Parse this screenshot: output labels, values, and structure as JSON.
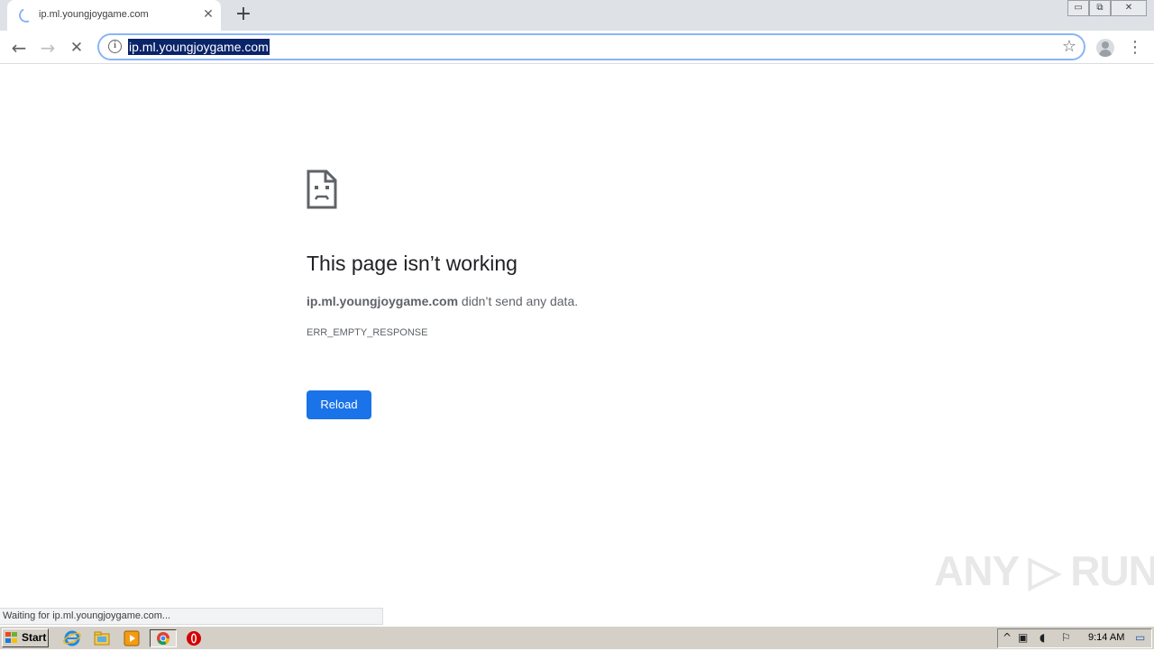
{
  "browser": {
    "tab": {
      "title": "ip.ml.youngjoygame.com",
      "close_glyph": "✕"
    },
    "new_tab_glyph": "+",
    "window_controls": {
      "minimize": "▭",
      "restore": "⧉",
      "close": "✕"
    },
    "toolbar": {
      "back_glyph": "←",
      "forward_glyph": "→",
      "stop_glyph": "✕",
      "info_glyph": "i",
      "url": "ip.ml.youngjoygame.com",
      "star_glyph": "☆",
      "menu_glyph": "⋮"
    },
    "accent_color": "#1a73e8",
    "selection_color": "#0a246a"
  },
  "error_page": {
    "icon": "sad-document-icon",
    "title": "This page isn’t working",
    "host": "ip.ml.youngjoygame.com",
    "message": " didn’t send any data.",
    "code": "ERR_EMPTY_RESPONSE",
    "reload_label": "Reload"
  },
  "status_bar": {
    "text": "Waiting for ip.ml.youngjoygame.com..."
  },
  "watermark": {
    "text": "ANY ▷ RUN"
  },
  "taskbar": {
    "start_label": "Start",
    "pinned": [
      {
        "name": "internet-explorer-icon",
        "glyph": "e"
      },
      {
        "name": "file-explorer-icon",
        "glyph": "▤"
      },
      {
        "name": "media-player-icon",
        "glyph": "▶"
      },
      {
        "name": "chrome-icon",
        "glyph": "◉"
      },
      {
        "name": "opera-icon",
        "glyph": "O"
      }
    ],
    "tray": {
      "show_hidden_glyph": "^",
      "network_glyph": "▣",
      "volume_glyph": "◖",
      "flag_glyph": "⚐",
      "time": "9:14 AM",
      "show_desktop_glyph": "▭"
    }
  }
}
